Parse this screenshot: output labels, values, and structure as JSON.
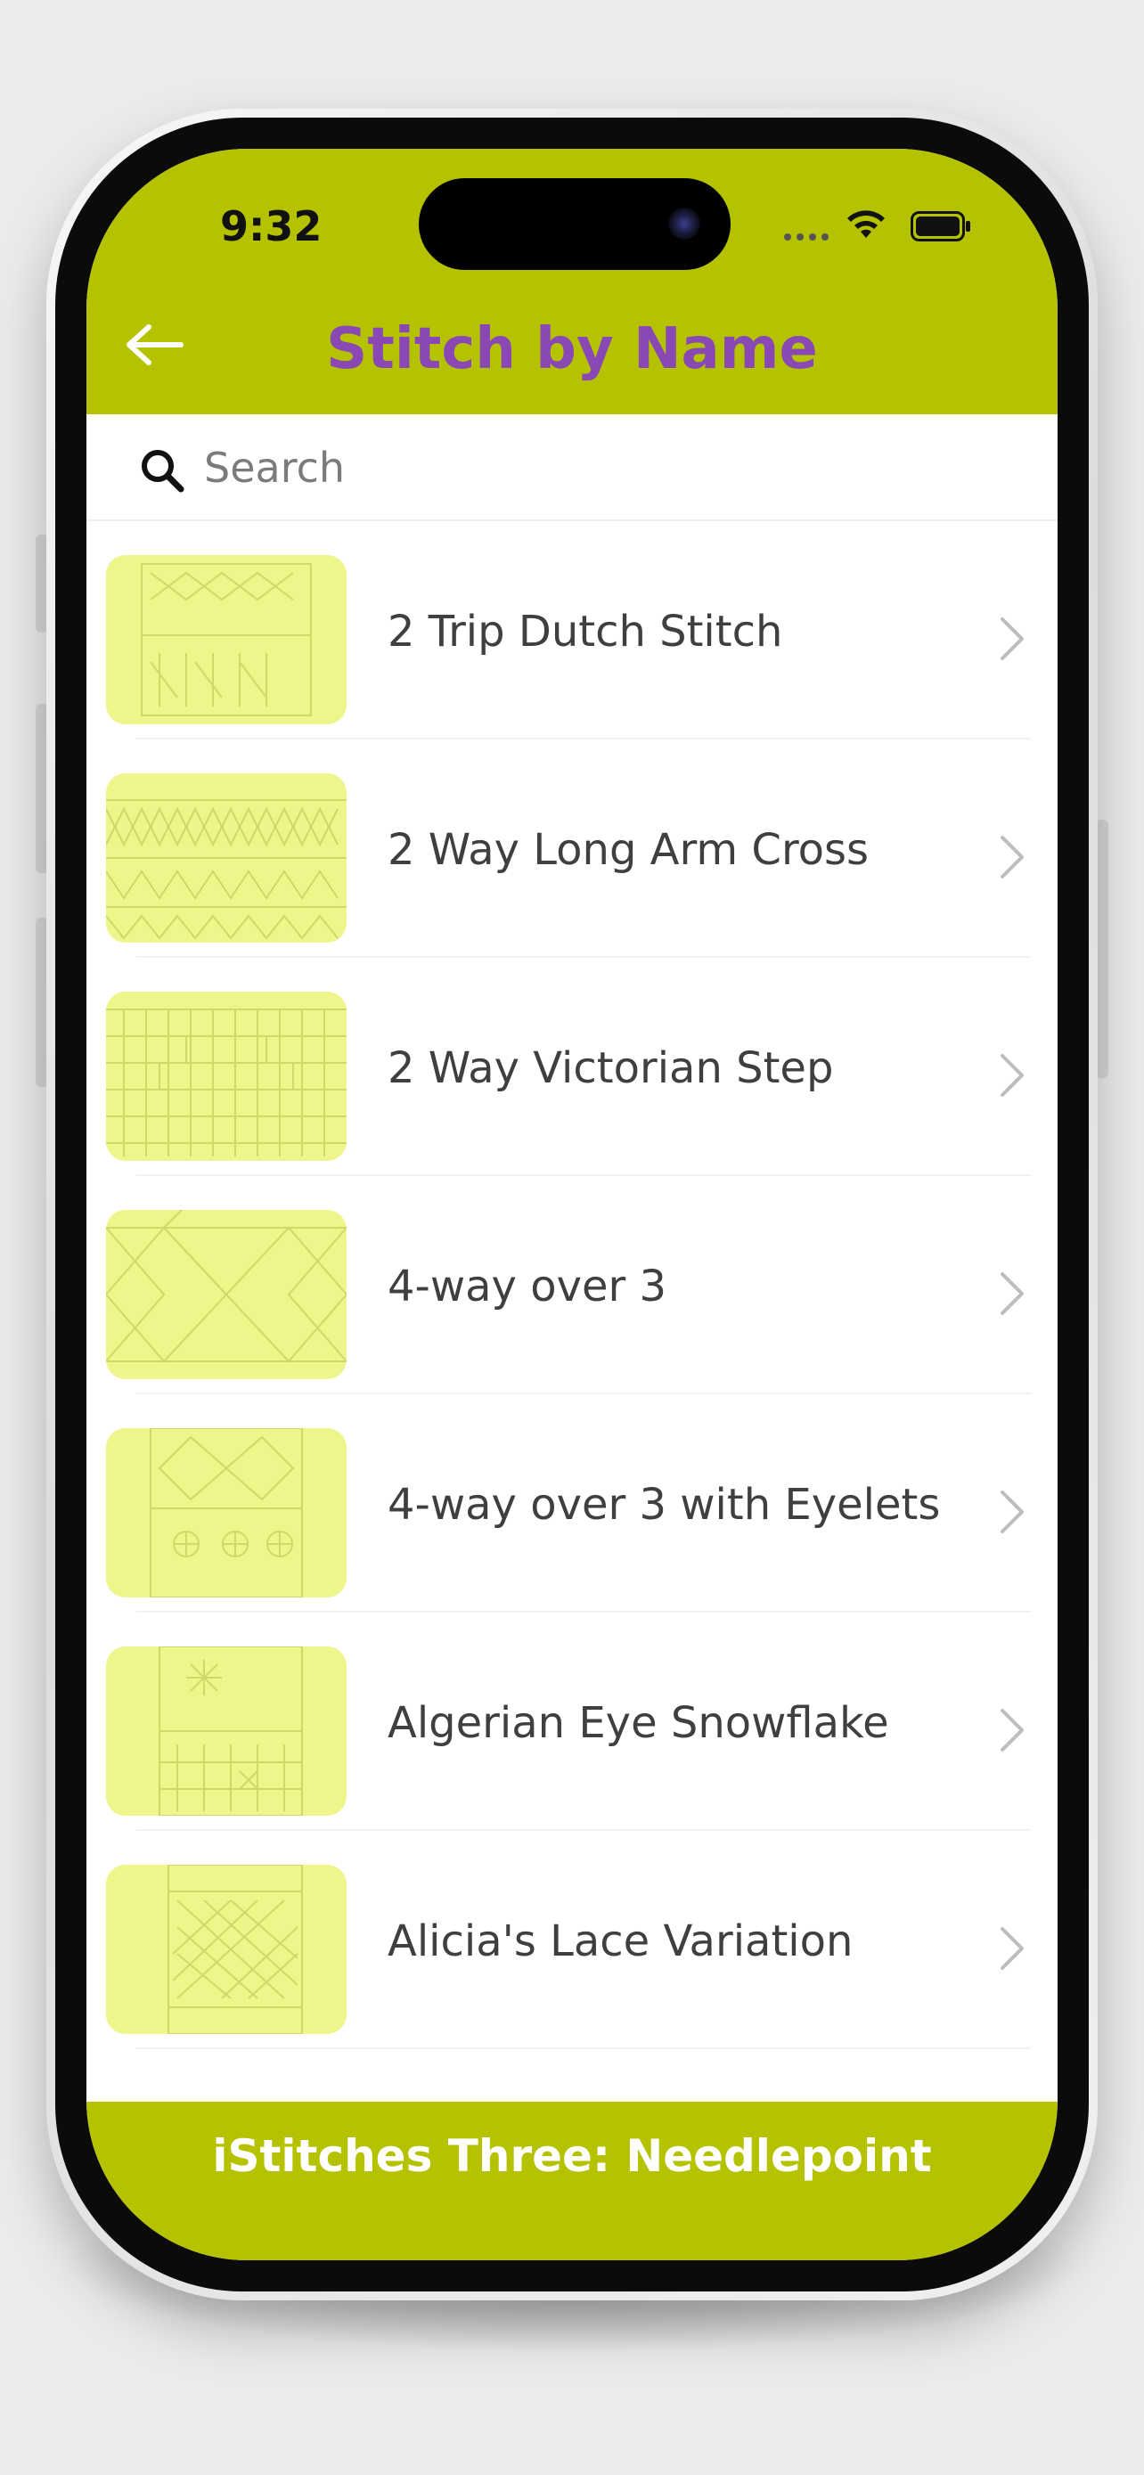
{
  "status_bar": {
    "time": "9:32"
  },
  "header": {
    "title": "Stitch by Name",
    "back_icon": "arrow-left-icon"
  },
  "search": {
    "placeholder": "Search",
    "value": ""
  },
  "stitches": [
    {
      "name": "2 Trip Dutch Stitch"
    },
    {
      "name": "2 Way Long Arm Cross"
    },
    {
      "name": "2 Way Victorian Step"
    },
    {
      "name": "4-way over 3"
    },
    {
      "name": "4-way over 3 with Eyelets"
    },
    {
      "name": "Algerian Eye Snowflake"
    },
    {
      "name": "Alicia's Lace Variation"
    }
  ],
  "footer": {
    "text": "iStitches Three: Needlepoint"
  },
  "colors": {
    "header_bg": "#b5c200",
    "title_text": "#8a48b4",
    "thumbnail_bg": "#eef58a",
    "footer_text": "#ffffff"
  }
}
